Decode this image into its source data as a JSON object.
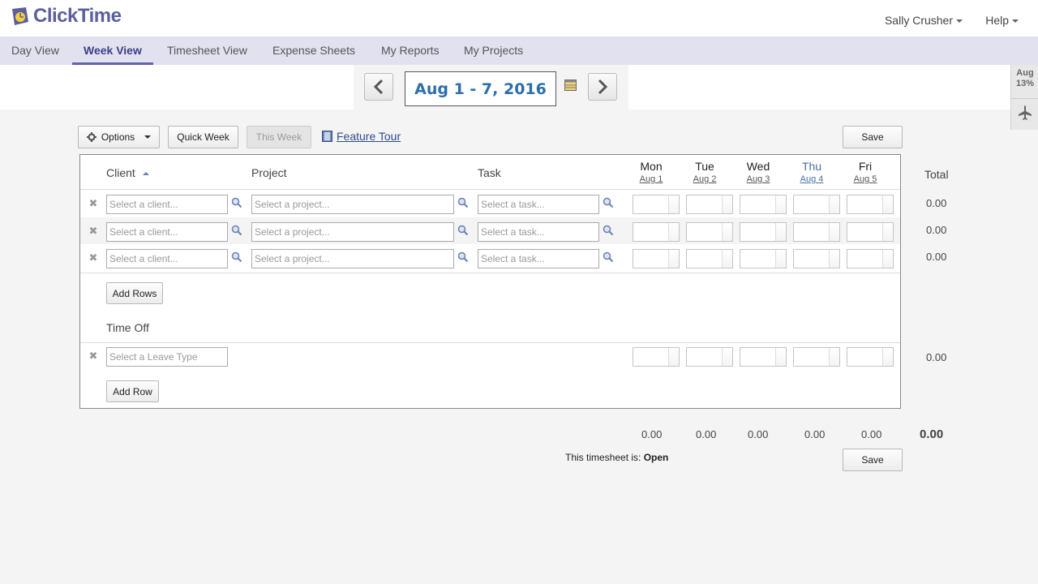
{
  "app": {
    "logo_text": "ClickTime"
  },
  "header": {
    "user_label": "Sally Crusher",
    "help_label": "Help"
  },
  "nav": {
    "items": [
      {
        "label": "Day View"
      },
      {
        "label": "Week View",
        "active": true
      },
      {
        "label": "Timesheet View"
      },
      {
        "label": "Expense Sheets"
      },
      {
        "label": "My Reports"
      },
      {
        "label": "My Projects"
      }
    ]
  },
  "week": {
    "range_label": "Aug 1 - 7, 2016"
  },
  "side": {
    "month": "Aug",
    "percent": "13%"
  },
  "toolbar": {
    "options_label": "Options",
    "quick_week_label": "Quick Week",
    "this_week_label": "This Week",
    "feature_tour_label": "Feature Tour",
    "save_label": "Save"
  },
  "columns": {
    "client": "Client",
    "project": "Project",
    "task": "Task",
    "total": "Total",
    "days": [
      {
        "name": "Mon",
        "date": "Aug 1"
      },
      {
        "name": "Tue",
        "date": "Aug 2"
      },
      {
        "name": "Wed",
        "date": "Aug 3"
      },
      {
        "name": "Thu",
        "date": "Aug 4",
        "today": true
      },
      {
        "name": "Fri",
        "date": "Aug 5"
      }
    ]
  },
  "rows": [
    {
      "client_ph": "Select a client...",
      "project_ph": "Select a project...",
      "task_ph": "Select a task...",
      "total": "0.00"
    },
    {
      "client_ph": "Select a client...",
      "project_ph": "Select a project...",
      "task_ph": "Select a task...",
      "total": "0.00"
    },
    {
      "client_ph": "Select a client...",
      "project_ph": "Select a project...",
      "task_ph": "Select a task...",
      "total": "0.00"
    }
  ],
  "add_rows_label": "Add Rows",
  "time_off": {
    "title": "Time Off",
    "leave_ph": "Select a Leave Type",
    "total": "0.00",
    "add_row_label": "Add Row"
  },
  "footer": {
    "day_totals": [
      "0.00",
      "0.00",
      "0.00",
      "0.00",
      "0.00"
    ],
    "grand_total": "0.00",
    "status_prefix": "This timesheet is:",
    "status_value": "Open",
    "save_label": "Save"
  },
  "colors": {
    "accent": "#5b5f9e",
    "nav_bg": "#e1e1f0",
    "date_text": "#2d6fa8"
  }
}
